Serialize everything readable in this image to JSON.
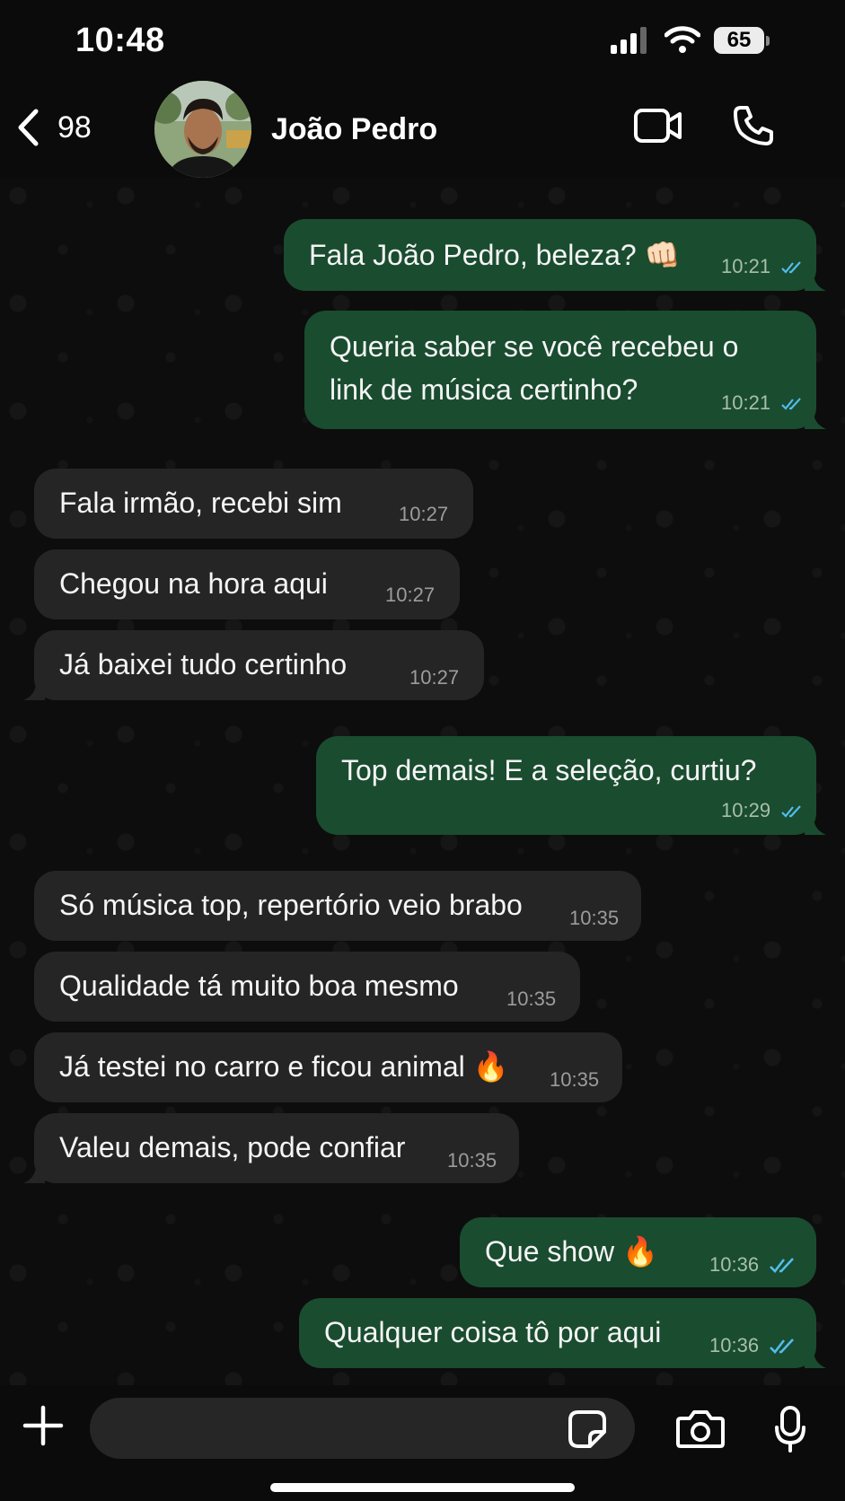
{
  "status_bar": {
    "time": "10:48",
    "battery": "65"
  },
  "header": {
    "back_count": "98",
    "contact_name": "João Pedro"
  },
  "messages": [
    {
      "direction": "out",
      "text": "Fala João Pedro, beleza? 👊🏻",
      "time": "10:21",
      "read": true
    },
    {
      "direction": "out",
      "text": "Queria saber se você recebeu o link de música certinho?",
      "time": "10:21",
      "read": true
    },
    {
      "direction": "in",
      "text": "Fala irmão, recebi sim",
      "time": "10:27"
    },
    {
      "direction": "in",
      "text": "Chegou na hora aqui",
      "time": "10:27"
    },
    {
      "direction": "in",
      "text": "Já baixei tudo certinho",
      "time": "10:27"
    },
    {
      "direction": "out",
      "text": "Top demais! E a seleção, curtiu?",
      "time": "10:29",
      "read": true
    },
    {
      "direction": "in",
      "text": "Só música top, repertório veio brabo",
      "time": "10:35"
    },
    {
      "direction": "in",
      "text": "Qualidade tá muito boa mesmo",
      "time": "10:35"
    },
    {
      "direction": "in",
      "text": "Já testei no carro e ficou animal 🔥",
      "time": "10:35"
    },
    {
      "direction": "in",
      "text": "Valeu demais, pode confiar",
      "time": "10:35"
    },
    {
      "direction": "out",
      "text": "Que show 🔥",
      "time": "10:36",
      "read": true
    },
    {
      "direction": "out",
      "text": "Qualquer coisa tô por aqui",
      "time": "10:36",
      "read": true
    }
  ],
  "input": {
    "placeholder": ""
  },
  "icons": {
    "back": "chevron-left-icon",
    "video_call": "video-camera-icon",
    "voice_call": "phone-icon",
    "add": "plus-icon",
    "sticker": "sticker-icon",
    "camera": "camera-icon",
    "mic": "microphone-icon"
  },
  "colors": {
    "outgoing_bubble": "#1a4c30",
    "incoming_bubble": "#252525",
    "read_tick": "#53bdeb",
    "background": "#0b0b0b"
  }
}
